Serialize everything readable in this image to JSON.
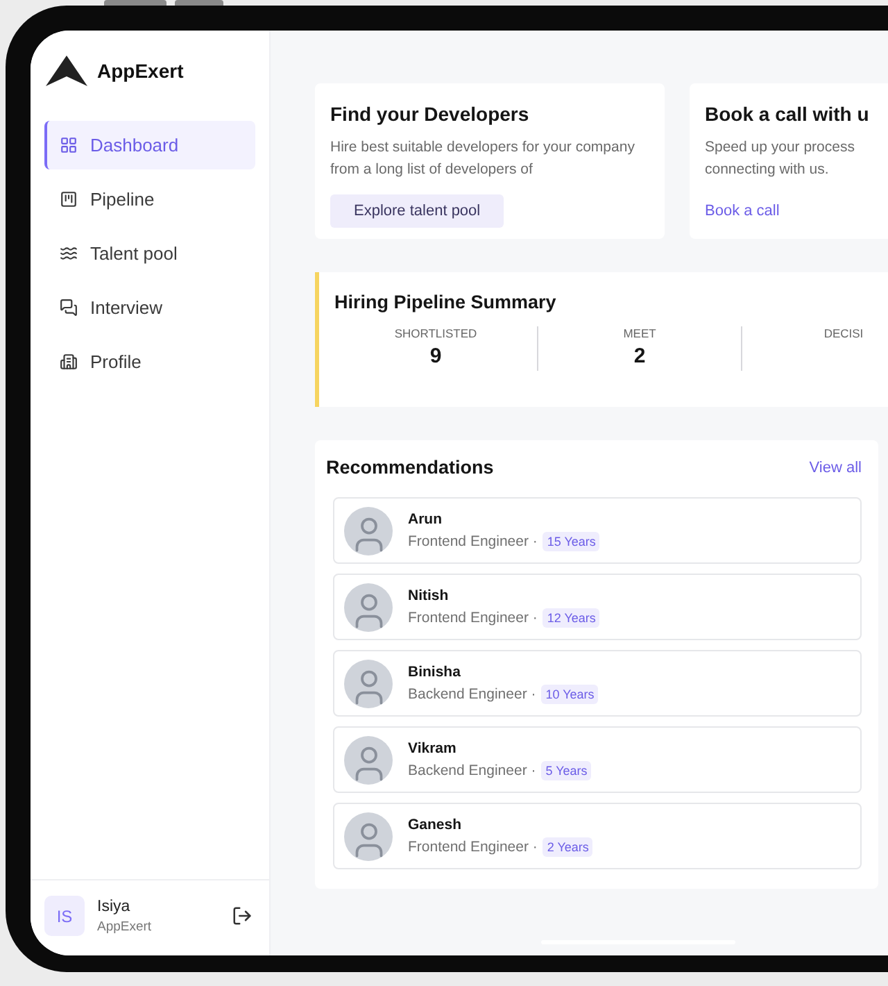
{
  "brand": {
    "name": "AppExert"
  },
  "sidebar": {
    "items": [
      {
        "label": "Dashboard",
        "kind": "dashboard",
        "selected": true
      },
      {
        "label": "Pipeline",
        "kind": "pipeline",
        "selected": false
      },
      {
        "label": "Talent pool",
        "kind": "talent",
        "selected": false
      },
      {
        "label": "Interview",
        "kind": "interview",
        "selected": false
      },
      {
        "label": "Profile",
        "kind": "profile",
        "selected": false
      }
    ],
    "user": {
      "initials": "IS",
      "name": "Isiya",
      "org": "AppExert"
    }
  },
  "cards": [
    {
      "title": "Find your Developers",
      "text": "Hire best suitable developers for your company from a long list of developers of",
      "action": {
        "kind": "button",
        "label": "Explore talent pool"
      }
    },
    {
      "title": "Book a call with u",
      "text": "Speed up your process",
      "text_2": "connecting with us.",
      "action": {
        "kind": "link",
        "label": "Book a call"
      }
    }
  ],
  "pipeline_summary": {
    "title": "Hiring Pipeline Summary",
    "stats": [
      {
        "label": "SHORTLISTED",
        "value": "9"
      },
      {
        "label": "MEET",
        "value": "2"
      },
      {
        "label": "DECISI"
      }
    ]
  },
  "recommendations": {
    "title": "Recommendations",
    "action": "View all",
    "people": [
      {
        "name": "Arun",
        "role": "Frontend Engineer ·",
        "experience": "15 Years"
      },
      {
        "name": "Nitish",
        "role": "Frontend Engineer ·",
        "experience": "12 Years"
      },
      {
        "name": "Binisha",
        "role": "Backend Engineer ·",
        "experience": "10 Years"
      },
      {
        "name": "Vikram",
        "role": "Backend Engineer ·",
        "experience": "5 Years"
      },
      {
        "name": "Ganesh",
        "role": "Frontend Engineer ·",
        "experience": "2 Years"
      }
    ]
  }
}
